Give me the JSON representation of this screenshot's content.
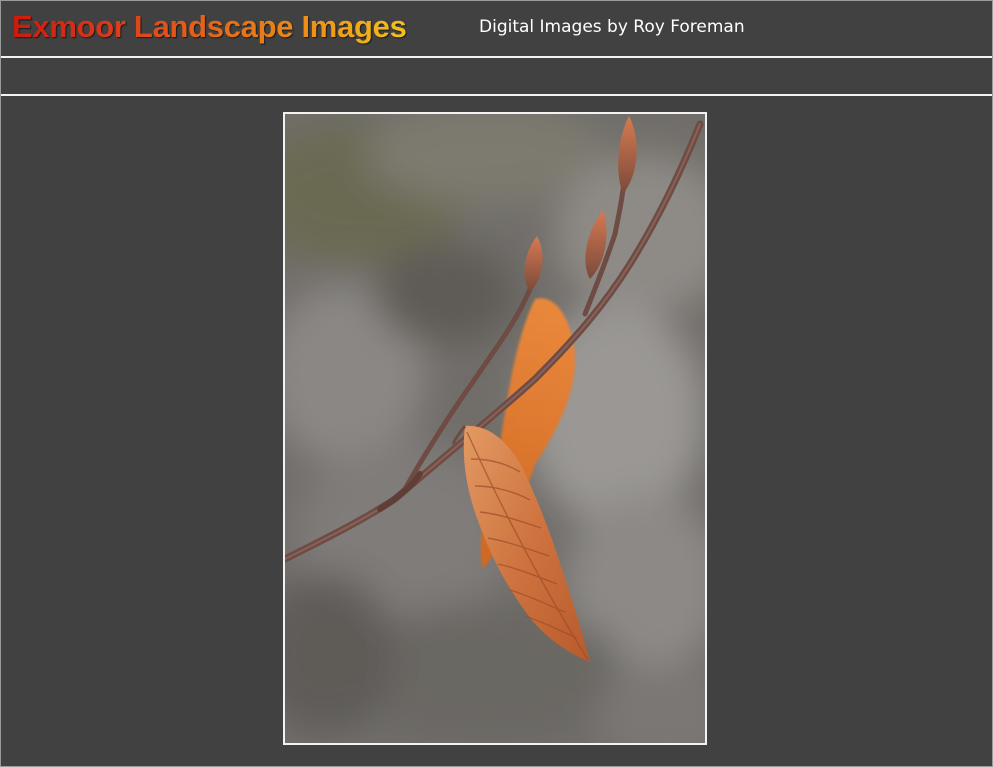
{
  "header": {
    "site_title": "Exmoor Landscape Images",
    "byline": "Digital Images by Roy Foreman"
  },
  "photo": {
    "subject-icon": "beech-leaf-on-twig-photo"
  },
  "colors": {
    "background": "#414141",
    "rule": "#f2f2f2",
    "title_gradient_start": "#cc1a0d",
    "title_gradient_end": "#f3c21c",
    "leaf_orange": "#d6763c"
  }
}
